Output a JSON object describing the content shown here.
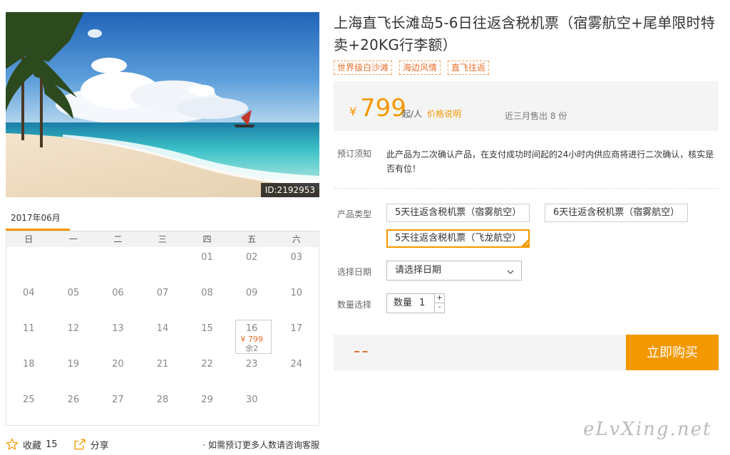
{
  "product": {
    "title": "上海直飞长滩岛5-6日往返含税机票（宿雾航空+尾单限时特卖+20KG行李额）",
    "image_id": "ID:2192953",
    "tags": [
      "世界级白沙滩",
      "海边风情",
      "直飞往返"
    ]
  },
  "price": {
    "currency": "¥",
    "amount": "799",
    "per": "起/人",
    "desc_link": "价格说明",
    "sold": "近三月售出 8 份"
  },
  "notice": {
    "label": "预订须知",
    "text": "此产品为二次确认产品，在支付成功时间起的24小时内供应商将进行二次确认，核实是否有位！"
  },
  "types": {
    "label": "产品类型",
    "options": [
      "5天往返含税机票（宿雾航空）",
      "6天往返含税机票（宿雾航空）",
      "5天往返含税机票（飞龙航空）"
    ]
  },
  "date": {
    "label": "选择日期",
    "value": "请选择日期"
  },
  "quantity": {
    "label": "数量选择",
    "field_label": "数量",
    "value": "1",
    "plus": "+",
    "minus": "-"
  },
  "checkout": {
    "total": "--",
    "buy_label": "立即购买"
  },
  "calendar": {
    "month": "2017年06月",
    "weekdays": [
      "日",
      "一",
      "二",
      "三",
      "四",
      "五",
      "六"
    ],
    "days": [
      "",
      "",
      "",
      "",
      "01",
      "02",
      "03",
      "04",
      "05",
      "06",
      "07",
      "08",
      "09",
      "10",
      "11",
      "12",
      "13",
      "14",
      "15",
      "16",
      "17",
      "18",
      "19",
      "20",
      "21",
      "22",
      "23",
      "24",
      "25",
      "26",
      "27",
      "28",
      "29",
      "30",
      ""
    ],
    "selected_day": "16",
    "selected_price": "¥ 799",
    "selected_stock": "余2"
  },
  "footer": {
    "fav_label": "收藏",
    "fav_count": "15",
    "share_label": "分享",
    "note": "· 如需预订更多人数请咨询客服"
  },
  "watermark": "eLvXing.net",
  "colors": {
    "accent": "#f39800",
    "price_text": "#e8702a"
  }
}
